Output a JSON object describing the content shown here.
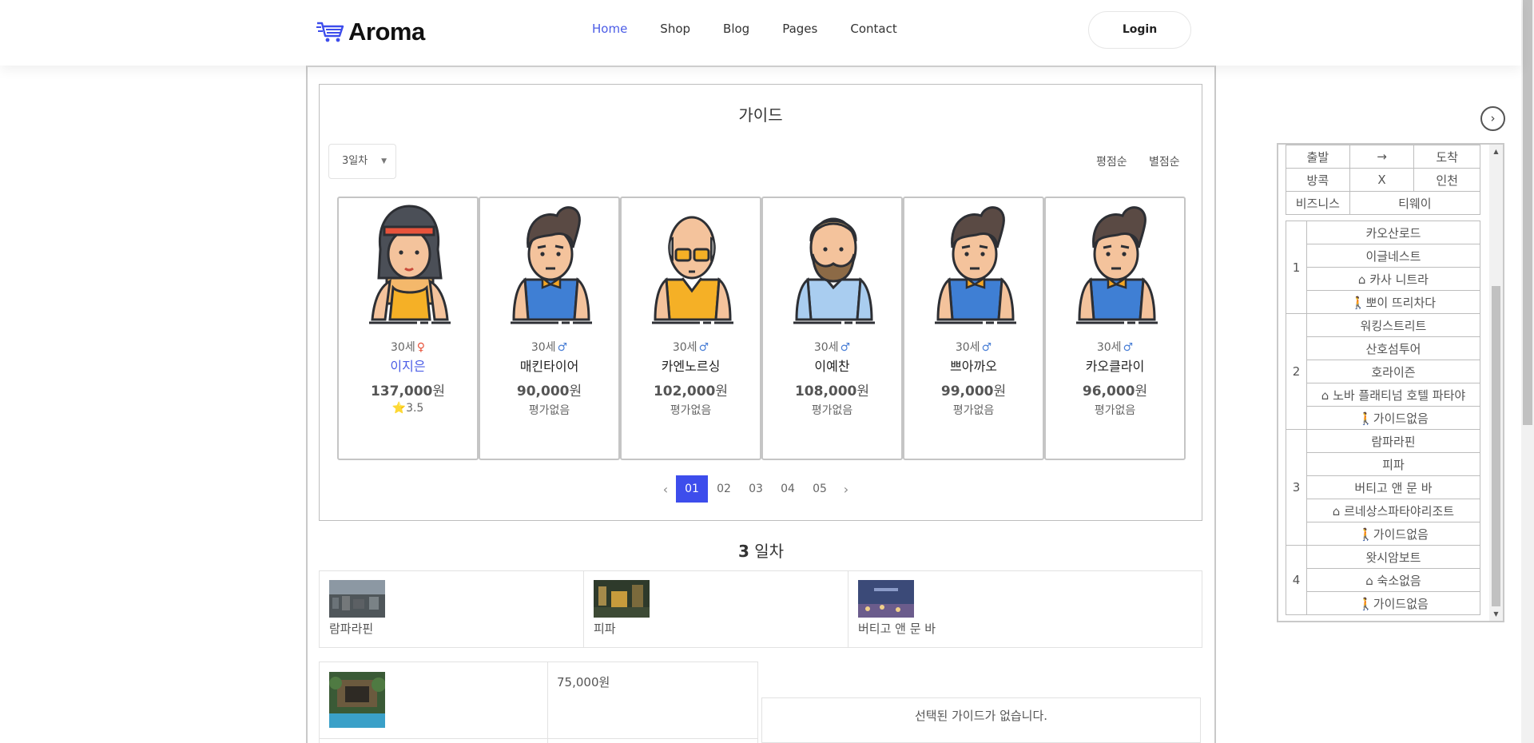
{
  "brand": {
    "name": "Aroma"
  },
  "nav": {
    "items": [
      "Home",
      "Shop",
      "Blog",
      "Pages",
      "Contact"
    ],
    "active": "Home",
    "login": "Login"
  },
  "guide": {
    "title": "가이드",
    "day_select": "3일차",
    "sort": {
      "rating": "평점순",
      "star": "별점순"
    },
    "cards": [
      {
        "age": "30세",
        "gender": "♀",
        "name": "이지은",
        "price": "137,000",
        "unit": "원",
        "rating_star": "⭐",
        "rating": "3.5",
        "selected": true
      },
      {
        "age": "30세",
        "gender": "♂",
        "name": "매킨타이어",
        "price": "90,000",
        "unit": "원",
        "rating": "평가없음"
      },
      {
        "age": "30세",
        "gender": "♂",
        "name": "카엔노르싱",
        "price": "102,000",
        "unit": "원",
        "rating": "평가없음"
      },
      {
        "age": "30세",
        "gender": "♂",
        "name": "이예찬",
        "price": "108,000",
        "unit": "원",
        "rating": "평가없음"
      },
      {
        "age": "30세",
        "gender": "♂",
        "name": "쁘아까오",
        "price": "99,000",
        "unit": "원",
        "rating": "평가없음"
      },
      {
        "age": "30세",
        "gender": "♂",
        "name": "카오클라이",
        "price": "96,000",
        "unit": "원",
        "rating": "평가없음"
      }
    ],
    "pages": [
      "01",
      "02",
      "03",
      "04",
      "05"
    ],
    "active_page": "01"
  },
  "day": {
    "num": "3",
    "label": "일차"
  },
  "pois": [
    "람파라핀",
    "피파",
    "버티고 앤 문 바"
  ],
  "hotel": {
    "price": "75,000원"
  },
  "no_guide": "선택된 가이드가 없습니다.",
  "itinerary": {
    "header": {
      "depart": "출발",
      "arrow": "→",
      "arrive": "도착",
      "origin": "방콕",
      "x": "X",
      "dest": "인천",
      "class": "비즈니스",
      "airline": "티웨이"
    },
    "days": [
      {
        "day": "1",
        "items": [
          {
            "t": "카오산로드"
          },
          {
            "t": "이글네스트"
          },
          {
            "t": "카사 니트라",
            "icon": "home"
          },
          {
            "t": "뽀이 뜨리차다",
            "icon": "walk"
          }
        ]
      },
      {
        "day": "2",
        "items": [
          {
            "t": "워킹스트리트"
          },
          {
            "t": "산호섬투어"
          },
          {
            "t": "호라이즌"
          },
          {
            "t": "노바 플래티넘 호텔 파타야",
            "icon": "home"
          },
          {
            "t": "가이드없음",
            "icon": "walk"
          }
        ]
      },
      {
        "day": "3",
        "items": [
          {
            "t": "람파라핀"
          },
          {
            "t": "피파"
          },
          {
            "t": "버티고 앤 문 바"
          },
          {
            "t": "르네상스파타야리조트",
            "icon": "home"
          },
          {
            "t": "가이드없음",
            "icon": "walk"
          }
        ]
      },
      {
        "day": "4",
        "items": [
          {
            "t": "왓시암보트"
          },
          {
            "t": "숙소없음",
            "icon": "home"
          },
          {
            "t": "가이드없음",
            "icon": "walk"
          }
        ]
      }
    ]
  },
  "colors": {
    "accent": "#3d4dec",
    "link": "#4b5ce6",
    "female": "#e8533b",
    "male": "#4a7fd6",
    "star": "#f2c200"
  }
}
